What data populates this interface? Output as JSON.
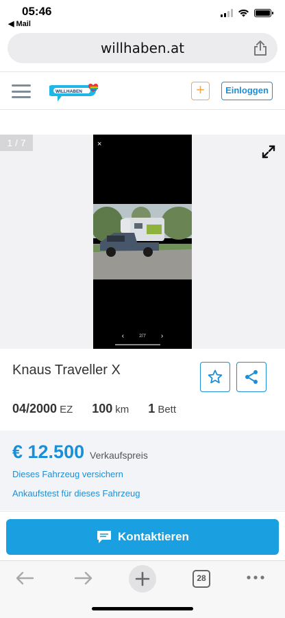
{
  "status_bar": {
    "time": "05:46",
    "back_app": "◀ Mail"
  },
  "browser": {
    "url": "willhaben.at",
    "tab_count": "28"
  },
  "header": {
    "add_symbol": "+",
    "login_label": "Einloggen",
    "logo_text": "WILLHABEN"
  },
  "gallery": {
    "counter": "1 / 7",
    "inner_counter": "2/7",
    "close_symbol": "×",
    "prev_symbol": "‹",
    "next_symbol": "›"
  },
  "listing": {
    "title": "Knaus Traveller X",
    "facts": [
      {
        "value": "04/2000",
        "unit": "EZ"
      },
      {
        "value": "100",
        "unit": "km"
      },
      {
        "value": "1",
        "unit": "Bett"
      }
    ],
    "price": "€ 12.500",
    "price_label": "Verkaufspreis",
    "link_insurance": "Dieses Fahrzeug versichern",
    "link_test": "Ankaufstest für dieses Fahrzeug"
  },
  "contact": {
    "label": "Kontaktieren"
  },
  "colors": {
    "accent": "#1a8fd8",
    "contact_bg": "#1a9fe0",
    "add_orange": "#f0a94a"
  }
}
